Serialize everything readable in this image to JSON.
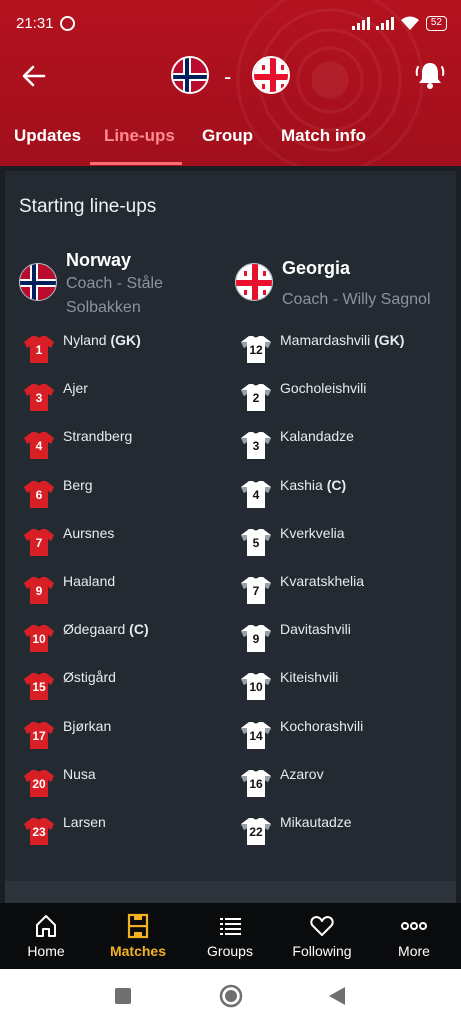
{
  "status_bar": {
    "time": "21:31",
    "battery": "52"
  },
  "header": {
    "home_team_flag": "norway-flag",
    "away_team_flag": "georgia-flag",
    "separator": "-"
  },
  "tabs": [
    {
      "label": "Updates",
      "active": false
    },
    {
      "label": "Line-ups",
      "active": true
    },
    {
      "label": "Group",
      "active": false
    },
    {
      "label": "Match info",
      "active": false
    }
  ],
  "lineups": {
    "title": "Starting line-ups",
    "home": {
      "name": "Norway",
      "coach_line1": "Coach - Ståle",
      "coach_line2": "Solbakken",
      "shirt_color": "#d91f26",
      "number_color": "#ffffff",
      "players": [
        {
          "number": "1",
          "name": "Nyland",
          "tag": "(GK)"
        },
        {
          "number": "3",
          "name": "Ajer",
          "tag": ""
        },
        {
          "number": "4",
          "name": "Strandberg",
          "tag": ""
        },
        {
          "number": "6",
          "name": "Berg",
          "tag": ""
        },
        {
          "number": "7",
          "name": "Aursnes",
          "tag": ""
        },
        {
          "number": "9",
          "name": "Haaland",
          "tag": ""
        },
        {
          "number": "10",
          "name": "Ødegaard",
          "tag": "(C)"
        },
        {
          "number": "15",
          "name": "Østigård",
          "tag": ""
        },
        {
          "number": "17",
          "name": "Bjørkan",
          "tag": ""
        },
        {
          "number": "20",
          "name": "Nusa",
          "tag": ""
        },
        {
          "number": "23",
          "name": "Larsen",
          "tag": ""
        }
      ]
    },
    "away": {
      "name": "Georgia",
      "coach_line1": "Coach - Willy Sagnol",
      "shirt_color": "#ffffff",
      "number_color": "#111111",
      "players": [
        {
          "number": "12",
          "name": "Mamardashvili",
          "tag": "(GK)"
        },
        {
          "number": "2",
          "name": "Gocholeishvili",
          "tag": ""
        },
        {
          "number": "3",
          "name": "Kalandadze",
          "tag": ""
        },
        {
          "number": "4",
          "name": "Kashia",
          "tag": "(C)"
        },
        {
          "number": "5",
          "name": "Kverkvelia",
          "tag": ""
        },
        {
          "number": "7",
          "name": "Kvaratskhelia",
          "tag": ""
        },
        {
          "number": "9",
          "name": "Davitashvili",
          "tag": ""
        },
        {
          "number": "10",
          "name": "Kiteishvili",
          "tag": ""
        },
        {
          "number": "14",
          "name": "Kochorashvili",
          "tag": ""
        },
        {
          "number": "16",
          "name": "Azarov",
          "tag": ""
        },
        {
          "number": "22",
          "name": "Mikautadze",
          "tag": ""
        }
      ]
    }
  },
  "bottom_nav": [
    {
      "label": "Home",
      "icon": "home-icon",
      "active": false
    },
    {
      "label": "Matches",
      "icon": "matches-icon",
      "active": true
    },
    {
      "label": "Groups",
      "icon": "groups-icon",
      "active": false
    },
    {
      "label": "Following",
      "icon": "heart-icon",
      "active": false
    },
    {
      "label": "More",
      "icon": "more-icon",
      "active": false
    }
  ],
  "colors": {
    "header_red": "#b5121f",
    "active_tab": "#ff8b92",
    "card_bg": "#232a31",
    "nav_active": "#f3b223"
  }
}
